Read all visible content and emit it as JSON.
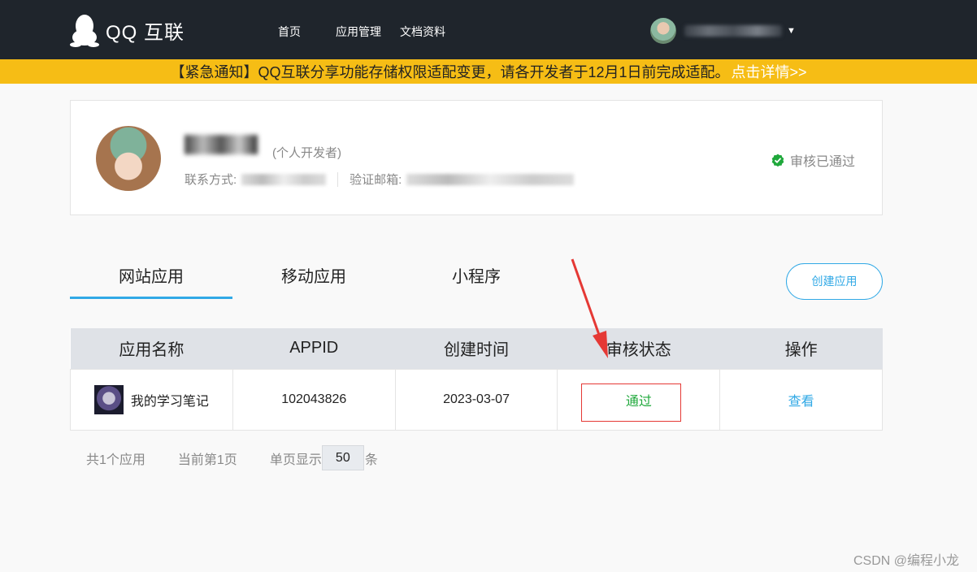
{
  "header": {
    "logo_text": "QQ 互联",
    "nav": [
      "首页",
      "应用管理",
      "文档资料"
    ]
  },
  "notice": {
    "text": "【紧急通知】QQ互联分享功能存储权限适配变更，请各开发者于12月1日前完成适配。",
    "link": "点击详情>>"
  },
  "profile": {
    "type": "(个人开发者)",
    "contact_label": "联系方式:",
    "email_label": "验证邮箱:",
    "status": "审核已通过"
  },
  "tabs": [
    {
      "label": "网站应用",
      "active": true
    },
    {
      "label": "移动应用",
      "active": false
    },
    {
      "label": "小程序",
      "active": false
    }
  ],
  "create_button": "创建应用",
  "table": {
    "headers": [
      "应用名称",
      "APPID",
      "创建时间",
      "审核状态",
      "操作"
    ],
    "rows": [
      {
        "name": "我的学习笔记",
        "appid": "102043826",
        "created": "2023-03-07",
        "status": "通过",
        "action": "查看"
      }
    ]
  },
  "pager": {
    "total": "共1个应用",
    "current": "当前第1页",
    "size_label": "单页显示",
    "size_value": "50",
    "unit": "条"
  },
  "watermark": "CSDN @编程小龙",
  "colors": {
    "accent": "#31a9e6",
    "notice_bg": "#f6bd15",
    "topbar_bg": "#1f252c",
    "pass": "#1fa83b",
    "annotation": "#e53935"
  }
}
